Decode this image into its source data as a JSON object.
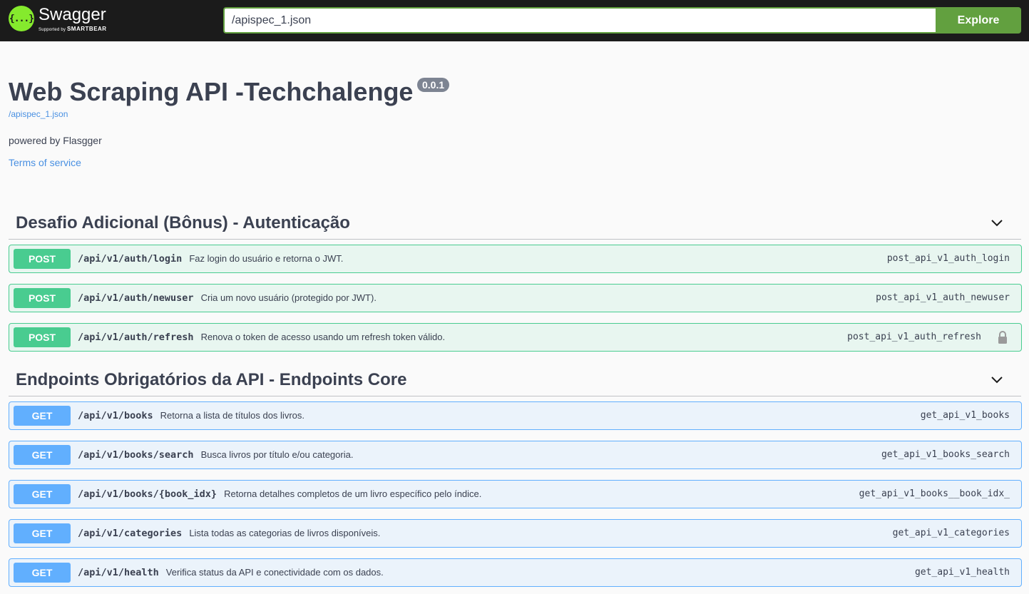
{
  "topbar": {
    "logo_title": "Swagger",
    "logo_supported": "Supported by",
    "logo_brand": "SMARTBEAR",
    "logo_glyph": "{...}",
    "url_value": "/apispec_1.json",
    "explore_label": "Explore"
  },
  "info": {
    "title": "Web Scraping API -Techchalenge",
    "version": "0.0.1",
    "spec_link": "/apispec_1.json",
    "powered_by": "powered by Flasgger",
    "terms": "Terms of service"
  },
  "tags": [
    {
      "name": "Desafio Adicional (Bônus) - Autenticação",
      "operations": [
        {
          "method": "POST",
          "path": "/api/v1/auth/login",
          "summary": "Faz login do usuário e retorna o JWT.",
          "operation_id": "post_api_v1_auth_login",
          "locked": false
        },
        {
          "method": "POST",
          "path": "/api/v1/auth/newuser",
          "summary": "Cria um novo usuário (protegido por JWT).",
          "operation_id": "post_api_v1_auth_newuser",
          "locked": false
        },
        {
          "method": "POST",
          "path": "/api/v1/auth/refresh",
          "summary": "Renova o token de acesso usando um refresh token válido.",
          "operation_id": "post_api_v1_auth_refresh",
          "locked": true
        }
      ]
    },
    {
      "name": "Endpoints Obrigatórios da API - Endpoints Core",
      "operations": [
        {
          "method": "GET",
          "path": "/api/v1/books",
          "summary": "Retorna a lista de títulos dos livros.",
          "operation_id": "get_api_v1_books",
          "locked": false
        },
        {
          "method": "GET",
          "path": "/api/v1/books/search",
          "summary": "Busca livros por título e/ou categoria.",
          "operation_id": "get_api_v1_books_search",
          "locked": false
        },
        {
          "method": "GET",
          "path": "/api/v1/books/{book_idx}",
          "summary": "Retorna detalhes completos de um livro específico pelo índice.",
          "operation_id": "get_api_v1_books__book_idx_",
          "locked": false
        },
        {
          "method": "GET",
          "path": "/api/v1/categories",
          "summary": "Lista todas as categorias de livros disponíveis.",
          "operation_id": "get_api_v1_categories",
          "locked": false
        },
        {
          "method": "GET",
          "path": "/api/v1/health",
          "summary": "Verifica status da API e conectividade com os dados.",
          "operation_id": "get_api_v1_health",
          "locked": false
        }
      ]
    }
  ],
  "colors": {
    "post": "#49cc90",
    "get": "#61affe",
    "explore": "#62a03f",
    "logo": "#85ea2d"
  }
}
